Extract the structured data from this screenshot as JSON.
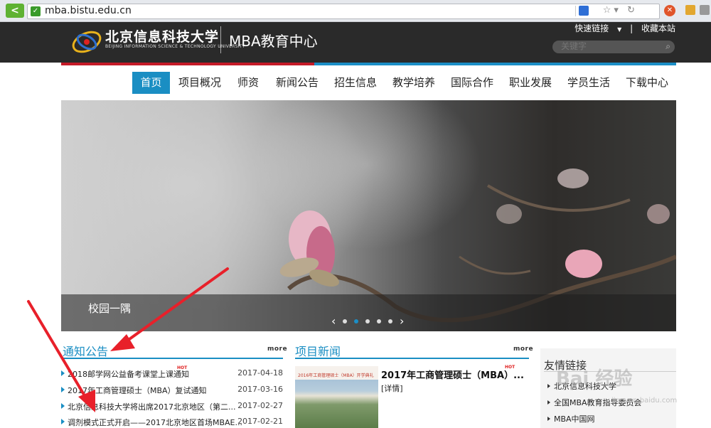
{
  "browser": {
    "url": "mba.bistu.edu.cn",
    "back_label": "<"
  },
  "header": {
    "logo_cn": "北京信息科技大学",
    "logo_en": "BEIJING INFORMATION SCIENCE & TECHNOLOGY UNIVERSITY",
    "center_name": "MBA教育中心",
    "quick_links": "快速链接",
    "bookmark": "收藏本站",
    "search_placeholder": "关键字"
  },
  "nav": [
    {
      "label": "首页",
      "active": true
    },
    {
      "label": "项目概况"
    },
    {
      "label": "师资"
    },
    {
      "label": "新闻公告"
    },
    {
      "label": "招生信息"
    },
    {
      "label": "教学培养"
    },
    {
      "label": "国际合作"
    },
    {
      "label": "职业发展"
    },
    {
      "label": "学员生活"
    },
    {
      "label": "下载中心"
    }
  ],
  "banner": {
    "caption": "校园一隅",
    "prev": "‹",
    "next": "›",
    "slides_total": 5,
    "slide_active": 2
  },
  "notices": {
    "title": "通知公告",
    "more": "more",
    "hot_label": "HOT",
    "items": [
      {
        "title": "2018邮学网公益备考课堂上课通知",
        "date": "2017-04-18",
        "hot": true
      },
      {
        "title": "2017年工商管理硕士（MBA）复试通知",
        "date": "2017-03-16"
      },
      {
        "title": "北京信息科技大学将出席2017北京地区（第二...",
        "date": "2017-02-27"
      },
      {
        "title": "调剂模式正式开启——2017北京地区首场MBAE...",
        "date": "2017-02-21"
      }
    ]
  },
  "news": {
    "title": "项目新闻",
    "more": "more",
    "headline": "2017年工商管理硕士（MBA）...",
    "hot_label": "HOT",
    "detail": "[详情]",
    "thumb_caption": "2016年工商管理硕士（MBA）开学典礼"
  },
  "friends": {
    "title": "友情链接",
    "items": [
      "北京信息科技大学",
      "全国MBA教育指导委员会",
      "MBA中国网"
    ]
  },
  "watermark": {
    "text": "Bai 经验",
    "sub": "jingyan.baidu.com"
  },
  "colors": {
    "accent_blue": "#1a8ec3",
    "accent_red": "#c41a27",
    "header_bg": "#2a2a2a",
    "annotation_red": "#e8202a"
  }
}
